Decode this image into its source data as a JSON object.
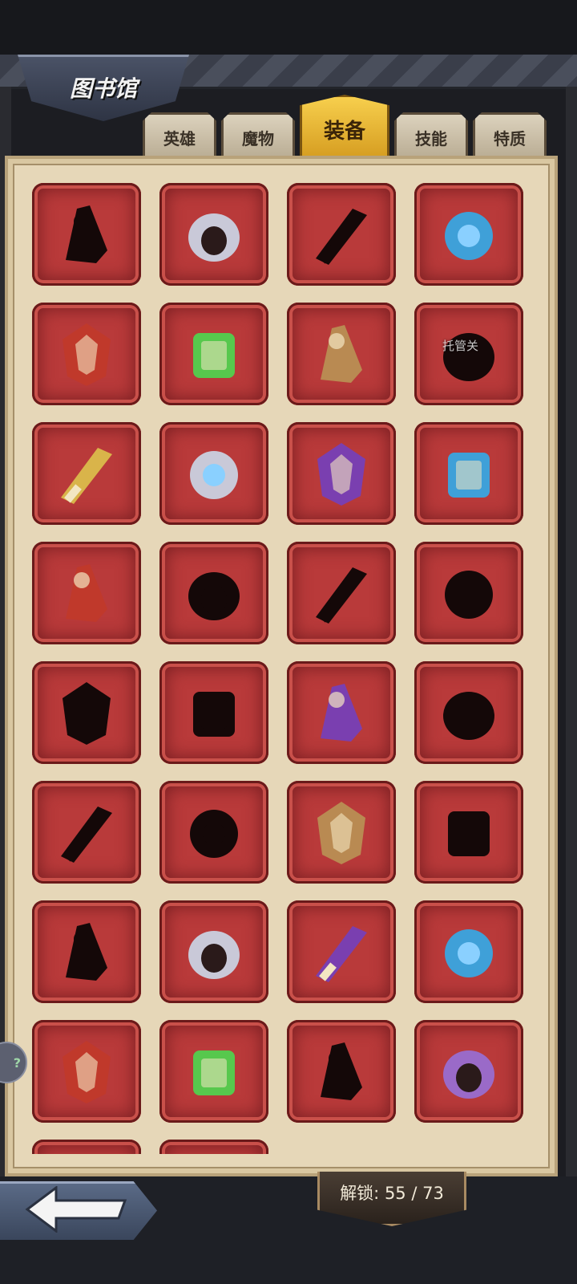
{
  "header": {
    "title": "图书馆"
  },
  "tabs": [
    {
      "label": "英雄",
      "active": false
    },
    {
      "label": "魔物",
      "active": false
    },
    {
      "label": "装备",
      "active": true
    },
    {
      "label": "技能",
      "active": false
    },
    {
      "label": "特质",
      "active": false
    }
  ],
  "items": [
    {
      "icon": "bottle-silhouette-icon",
      "locked": true
    },
    {
      "icon": "hooded-helmet-icon",
      "locked": false
    },
    {
      "icon": "cloak-silhouette-icon",
      "locked": true
    },
    {
      "icon": "mantle-icon",
      "locked": false
    },
    {
      "icon": "winged-helmet-icon",
      "locked": false
    },
    {
      "icon": "spellbook-icon",
      "locked": false
    },
    {
      "icon": "ruby-amulet-icon",
      "locked": false
    },
    {
      "icon": "shuriken-silhouette-icon",
      "locked": true
    },
    {
      "icon": "gem-ring-icon",
      "locked": false
    },
    {
      "icon": "claw-gauntlet-icon",
      "locked": false
    },
    {
      "icon": "golden-gauntlet-icon",
      "locked": false
    },
    {
      "icon": "witch-hat-icon",
      "locked": false
    },
    {
      "icon": "war-hammer-icon",
      "locked": false
    },
    {
      "icon": "greatsword-silhouette-icon",
      "locked": true
    },
    {
      "icon": "dagger-silhouette-icon",
      "locked": true
    },
    {
      "icon": "serrated-blade-silhouette-icon",
      "locked": true
    },
    {
      "icon": "spear-silhouette-icon",
      "locked": true
    },
    {
      "icon": "battle-axe-silhouette-icon",
      "locked": true
    },
    {
      "icon": "jade-blade-icon",
      "locked": false
    },
    {
      "icon": "jagged-sword-silhouette-icon",
      "locked": true
    },
    {
      "icon": "long-sword-silhouette-icon",
      "locked": true
    },
    {
      "icon": "mace-silhouette-icon",
      "locked": true
    },
    {
      "icon": "crystal-orb-icon",
      "locked": false
    },
    {
      "icon": "ring-silhouette-icon",
      "locked": true
    },
    {
      "icon": "armor-silhouette-icon",
      "locked": true
    },
    {
      "icon": "horn-icon",
      "locked": false
    },
    {
      "icon": "spiked-shield-icon",
      "locked": false
    },
    {
      "icon": "pumpkin-ring-icon",
      "locked": false
    },
    {
      "icon": "bronze-helmet-icon",
      "locked": false
    },
    {
      "icon": "horned-crown-icon",
      "locked": false
    },
    {
      "icon": "halo-ring-silhouette-icon",
      "locked": true
    },
    {
      "icon": "laurel-shield-emblem-icon",
      "locked": false
    }
  ],
  "overlay": {
    "text": "托管关"
  },
  "footer": {
    "unlock_text": "解锁: 55 / 73"
  },
  "help": {
    "label": "?"
  },
  "colors": {
    "slot": "#b93a3a",
    "panel": "#e6d7b8",
    "tab_active": "#f1b933"
  }
}
